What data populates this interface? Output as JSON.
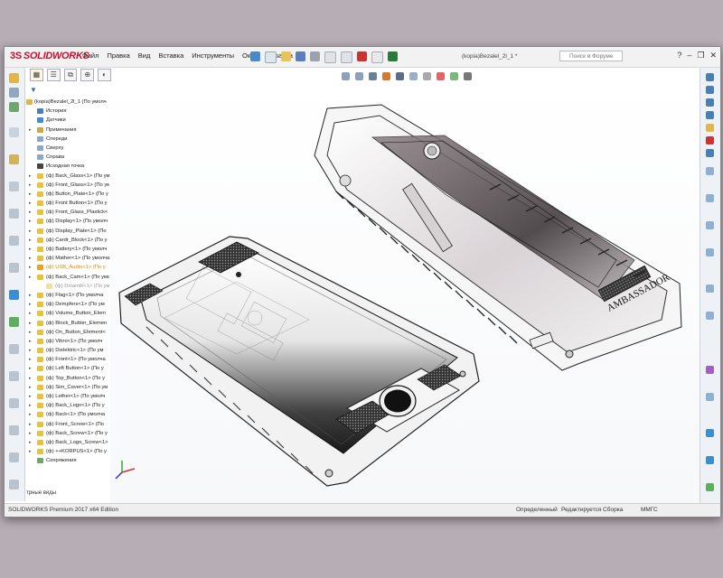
{
  "app": {
    "logo_text": "SOLIDWORKS",
    "logo_mark": "3S",
    "menu": [
      "Файл",
      "Правка",
      "Вид",
      "Вставка",
      "Инструменты",
      "Окно",
      "Справка"
    ],
    "document_title": "(kopia)Bezalel_2l_1 *",
    "search_placeholder": "Поиск в Форуме",
    "window_buttons": [
      "?",
      "–",
      "❐",
      "✕"
    ]
  },
  "tree": {
    "root": "(kopia)Bezalel_2l_1  (По умолч",
    "items": [
      {
        "label": "История",
        "icon": "history-icon",
        "level": 1,
        "expandable": false
      },
      {
        "label": "Датчики",
        "icon": "sensor-icon",
        "level": 1,
        "expandable": false
      },
      {
        "label": "Примечания",
        "icon": "annotation-icon",
        "level": 1,
        "expandable": true
      },
      {
        "label": "Спереди",
        "icon": "plane-icon",
        "level": 1,
        "expandable": false
      },
      {
        "label": "Сверху",
        "icon": "plane-icon",
        "level": 1,
        "expandable": false
      },
      {
        "label": "Справа",
        "icon": "plane-icon",
        "level": 1,
        "expandable": false
      },
      {
        "label": "Исходная точка",
        "icon": "origin-icon",
        "level": 1,
        "expandable": false
      },
      {
        "label": "(ф) Back_Glass<1> (По ум",
        "icon": "part-icon",
        "level": 1,
        "expandable": true
      },
      {
        "label": "(ф) Front_Glass<1> (По ум",
        "icon": "part-icon",
        "level": 1,
        "expandable": true
      },
      {
        "label": "(ф) Button_Plate<1> (По у",
        "icon": "part-icon",
        "level": 1,
        "expandable": true
      },
      {
        "label": "(ф) Front Button<1> (По у",
        "icon": "part-icon",
        "level": 1,
        "expandable": true
      },
      {
        "label": "(ф) Front_Glass_Plastick<",
        "icon": "part-icon",
        "level": 1,
        "expandable": true
      },
      {
        "label": "(ф) Display<1> (По умолч",
        "icon": "part-icon",
        "level": 1,
        "expandable": true
      },
      {
        "label": "(ф) Display_Plate<1> (По",
        "icon": "part-icon",
        "level": 1,
        "expandable": true
      },
      {
        "label": "(ф) Cardr_Block<1> (По у",
        "icon": "part-icon",
        "level": 1,
        "expandable": true
      },
      {
        "label": "(ф) Battery<1> (По умолч",
        "icon": "part-icon",
        "level": 1,
        "expandable": true
      },
      {
        "label": "(ф) Mather<1> (По умолча",
        "icon": "part-icon",
        "level": 1,
        "expandable": true
      },
      {
        "label": "(ф) USB_Audio<1> (По у",
        "icon": "warning-part-icon",
        "level": 1,
        "expandable": true,
        "warn": true
      },
      {
        "label": "(ф) Back_Cam<1> (По умо",
        "icon": "part-icon",
        "level": 1,
        "expandable": true
      },
      {
        "label": "(ф) Dinamik<1> (По умол",
        "icon": "part-icon",
        "level": 2,
        "expandable": false,
        "faded": true
      },
      {
        "label": "(ф) Flag<1> (По умолча",
        "icon": "part-icon",
        "level": 1,
        "expandable": true
      },
      {
        "label": "(ф) Dempfers<1> (По ум",
        "icon": "part-icon",
        "level": 1,
        "expandable": true
      },
      {
        "label": "(ф) Volume_Button_Elem",
        "icon": "part-icon",
        "level": 1,
        "expandable": true
      },
      {
        "label": "(ф) Block_Button_Elemen",
        "icon": "part-icon",
        "level": 1,
        "expandable": true
      },
      {
        "label": "(ф) On_Button_Element<",
        "icon": "part-icon",
        "level": 1,
        "expandable": true
      },
      {
        "label": "(ф) Vibro<1> (По умолч",
        "icon": "part-icon",
        "level": 1,
        "expandable": true
      },
      {
        "label": "(ф) Dielektric<1> (По ум",
        "icon": "part-icon",
        "level": 1,
        "expandable": true
      },
      {
        "label": "(ф) Front<1> (По умолча",
        "icon": "part-icon",
        "level": 1,
        "expandable": true
      },
      {
        "label": "(ф) Left Button<1> (По у",
        "icon": "part-icon",
        "level": 1,
        "expandable": true
      },
      {
        "label": "(ф) Top_Button<1> (По у",
        "icon": "part-icon",
        "level": 1,
        "expandable": true
      },
      {
        "label": "(ф) Sim_Cover<1> (По ум",
        "icon": "part-icon",
        "level": 1,
        "expandable": true
      },
      {
        "label": "(ф) Lether<1> (По умолч",
        "icon": "part-icon",
        "level": 1,
        "expandable": true
      },
      {
        "label": "(ф) Back_Logo<1> (По у",
        "icon": "part-icon",
        "level": 1,
        "expandable": true
      },
      {
        "label": "(ф) Back<1> (По умолча",
        "icon": "part-icon",
        "level": 1,
        "expandable": true
      },
      {
        "label": "(ф) Front_Screw<1> (По",
        "icon": "part-icon",
        "level": 1,
        "expandable": true
      },
      {
        "label": "(ф) Back_Screw<1> (По у",
        "icon": "part-icon",
        "level": 1,
        "expandable": true
      },
      {
        "label": "(ф) Back_Logo_Screw<1>",
        "icon": "part-icon",
        "level": 1,
        "expandable": true
      },
      {
        "label": "(ф) ++KORPUS<1> (По у",
        "icon": "part-icon",
        "level": 1,
        "expandable": true
      },
      {
        "label": "Сопряжения",
        "icon": "mates-icon",
        "level": 1,
        "expandable": false
      }
    ]
  },
  "bottom_tab": "трные виды",
  "status": {
    "edition": "SOLIDWORKS Premium 2017 x64 Edition",
    "state": "Определенный",
    "mode": "Редактируется Сборка",
    "units": "ММГС"
  },
  "colors": {
    "accent": "#2a6fb5",
    "part": "#e8c23a",
    "warning": "#f0a020"
  }
}
